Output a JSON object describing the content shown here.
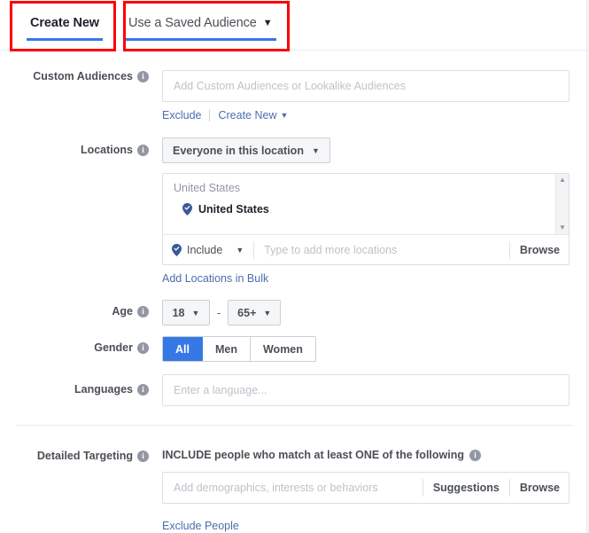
{
  "tabs": [
    {
      "label": "Create New",
      "active": true,
      "caret": false
    },
    {
      "label": "Use a Saved Audience",
      "active": false,
      "caret": true
    }
  ],
  "annotations": {
    "highlight_color": "#fb0007",
    "boxes": [
      "create-new-tab",
      "use-a-saved-audience-tab"
    ]
  },
  "colors": {
    "accent_blue": "#3578e5",
    "link_blue": "#4b6eaf",
    "label_gray": "#4b4f56",
    "placeholder_gray": "#bec3c9",
    "border_gray": "#dddfe2"
  },
  "custom_audiences": {
    "label": "Custom Audiences",
    "info": "i",
    "placeholder": "Add Custom Audiences or Lookalike Audiences",
    "value": "",
    "exclude_link": "Exclude",
    "create_new_link": "Create New",
    "create_new_caret": "▼"
  },
  "locations": {
    "label": "Locations",
    "info": "i",
    "scope_dropdown": "Everyone in this location",
    "scope_caret": "▼",
    "list_heading": "United States",
    "selected": [
      {
        "name": "United States",
        "icon": "location-pin-check-icon"
      }
    ],
    "scroll_up": "▲",
    "scroll_down": "▼",
    "include_label": "Include",
    "include_caret": "▼",
    "input_placeholder": "Type to add more locations",
    "input_value": "",
    "browse_label": "Browse",
    "bulk_link": "Add Locations in Bulk"
  },
  "age": {
    "label": "Age",
    "info": "i",
    "min": "18",
    "max": "65+",
    "separator": "-",
    "caret": "▼"
  },
  "gender": {
    "label": "Gender",
    "info": "i",
    "options": [
      "All",
      "Men",
      "Women"
    ],
    "selected": "All"
  },
  "languages": {
    "label": "Languages",
    "info": "i",
    "placeholder": "Enter a language...",
    "value": ""
  },
  "detailed_targeting": {
    "label": "Detailed Targeting",
    "info": "i",
    "include_title": "INCLUDE people who match at least ONE of the following",
    "include_info": "i",
    "placeholder": "Add demographics, interests or behaviors",
    "value": "",
    "suggestions_label": "Suggestions",
    "browse_label": "Browse",
    "exclude_link": "Exclude People"
  }
}
